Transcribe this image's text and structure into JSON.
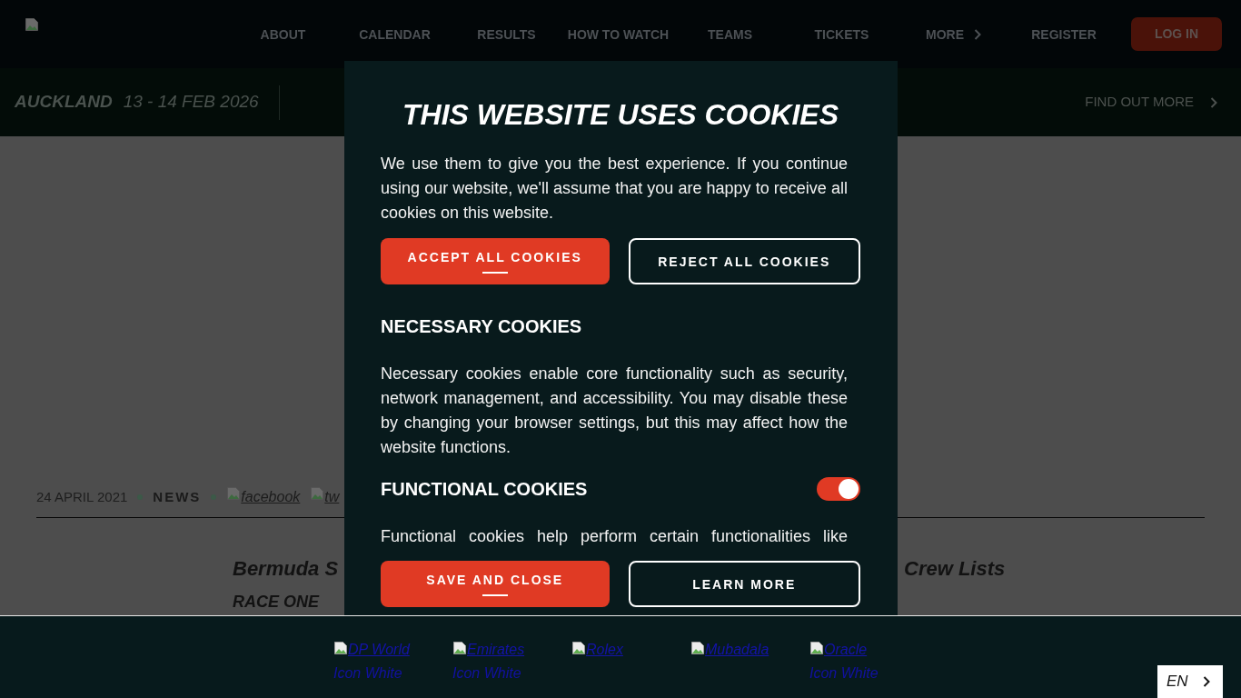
{
  "header": {
    "nav": [
      {
        "label": "ABOUT",
        "kind": "link"
      },
      {
        "label": "CALENDAR",
        "kind": "link"
      },
      {
        "label": "RESULTS",
        "kind": "link"
      },
      {
        "label": "HOW TO WATCH",
        "kind": "link"
      },
      {
        "label": "TEAMS",
        "kind": "link"
      },
      {
        "label": "TICKETS",
        "kind": "link"
      },
      {
        "label": "MORE",
        "kind": "menu"
      }
    ],
    "register": "REGISTER",
    "login": "LOG IN"
  },
  "event_banner": {
    "city": "AUCKLAND",
    "dates": "13 - 14 FEB 2026",
    "link": "FIND OUT MORE"
  },
  "article": {
    "date": "24 APRIL 2021",
    "category": "NEWS",
    "share_links": [
      "facebook",
      "tw"
    ],
    "title_start": "Bermuda S",
    "title_end": "Crew Lists",
    "subtitle": "RACE ONE"
  },
  "cookie_dialog": {
    "title": "THIS WEBSITE USES COOKIES",
    "intro": "We use them to give you the best experience. If you continue using our website, we'll assume that you are happy to receive all cookies on this website.",
    "top_buttons": [
      {
        "label": "ACCEPT ALL COOKIES",
        "kind": "primary"
      },
      {
        "label": "REJECT ALL COOKIES",
        "kind": "outline"
      }
    ],
    "sections": [
      {
        "heading": "NECESSARY COOKIES",
        "text": "Necessary cookies enable core functionality such as security, network management, and accessibility. You may disable these by changing your browser settings, but this may affect how the website functions."
      },
      {
        "heading": "FUNCTIONAL COOKIES",
        "on": true,
        "text": "Functional cookies help perform certain functionalities like"
      }
    ],
    "bottom_buttons": [
      {
        "label": "SAVE AND CLOSE",
        "kind": "primary"
      },
      {
        "label": "LEARN MORE",
        "kind": "outline"
      }
    ]
  },
  "footer": {
    "sponsors": [
      {
        "name": "DP World",
        "caption": "Icon White"
      },
      {
        "name": "Emirates",
        "caption": "Icon White"
      },
      {
        "name": "Rolex"
      },
      {
        "name": "Mubadala"
      },
      {
        "name": "Oracle",
        "caption": "Icon White"
      }
    ],
    "language": "EN"
  }
}
